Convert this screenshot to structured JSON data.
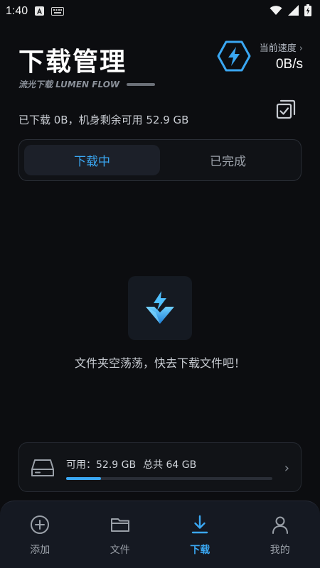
{
  "status_bar": {
    "time": "1:40",
    "icons": [
      "app-a-icon",
      "keyboard-icon",
      "wifi-icon",
      "signal-icon",
      "battery-charging-icon"
    ]
  },
  "header": {
    "title": "下载管理",
    "subtitle": "流光下载 LUMEN FLOW",
    "speed_label": "当前速度",
    "speed_chevron": "›",
    "speed_value": "0B/s"
  },
  "storage_summary": "已下载 0B，机身剩余可用 52.9 GB",
  "tabs": [
    {
      "label": "下载中",
      "active": true
    },
    {
      "label": "已完成",
      "active": false
    }
  ],
  "empty_state": {
    "message": "文件夹空荡荡，快去下载文件吧！"
  },
  "storage_card": {
    "available": "可用：52.9 GB",
    "total": "总共 64 GB",
    "used_fraction": 0.17,
    "chevron": "›"
  },
  "bottom_nav": {
    "items": [
      {
        "label": "添加",
        "icon": "plus-circle-icon",
        "active": false
      },
      {
        "label": "文件",
        "icon": "folder-icon",
        "active": false
      },
      {
        "label": "下载",
        "icon": "download-icon",
        "active": true
      },
      {
        "label": "我的",
        "icon": "person-icon",
        "active": false
      }
    ]
  },
  "colors": {
    "accent": "#3aa7f2",
    "background": "#0c0d10"
  }
}
